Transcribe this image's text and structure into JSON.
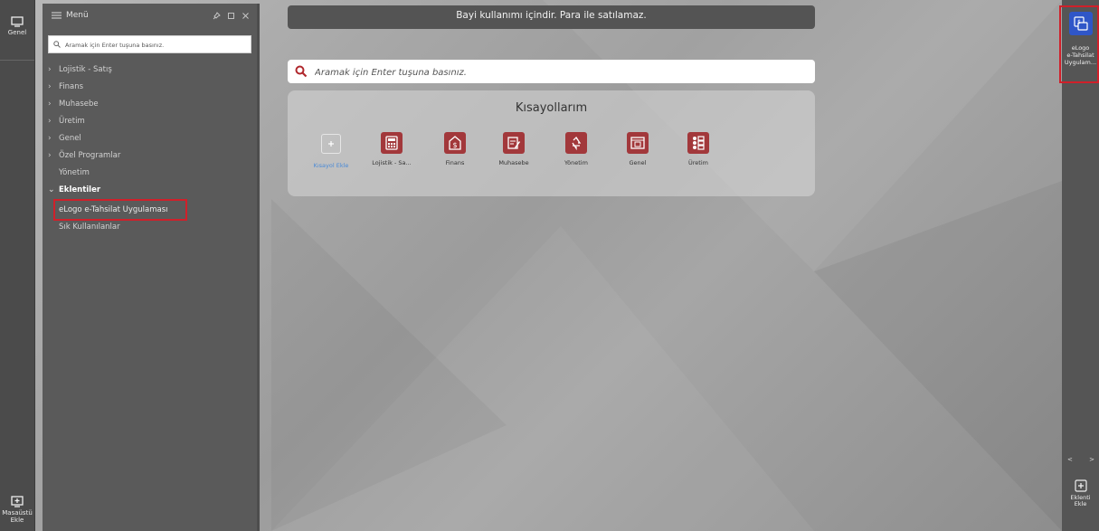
{
  "left_strip": {
    "top_item": {
      "label": "Genel",
      "icon": "monitor-icon"
    },
    "bottom_item": {
      "label_line1": "Masaüstü",
      "label_line2": "Ekle",
      "icon": "add-desktop-icon"
    }
  },
  "menu": {
    "title": "Menü",
    "controls": [
      "pin-icon",
      "restore-icon",
      "close-icon"
    ],
    "search_placeholder": "Aramak için Enter tuşuna basınız.",
    "items": [
      {
        "label": "Lojistik - Satış",
        "expandable": true
      },
      {
        "label": "Finans",
        "expandable": true
      },
      {
        "label": "Muhasebe",
        "expandable": true
      },
      {
        "label": "Üretim",
        "expandable": true
      },
      {
        "label": "Genel",
        "expandable": true
      },
      {
        "label": "Özel Programlar",
        "expandable": true
      },
      {
        "label": "Yönetim",
        "expandable": false
      },
      {
        "label": "Eklentiler",
        "expanded": true
      },
      {
        "label": "eLogo e-Tahsilat Uygulaması",
        "sub": true
      },
      {
        "label": "Sık Kullanılanlar",
        "expandable": false
      }
    ]
  },
  "banner": {
    "text": "Bayi kullanımı içindir. Para ile satılamaz."
  },
  "main_search": {
    "placeholder": "Aramak için Enter tuşuna basınız."
  },
  "shortcuts": {
    "title": "Kısayollarım",
    "tiles": [
      {
        "label": "Kısayol Ekle",
        "icon": "add-shortcut-icon"
      },
      {
        "label": "Lojistik - Sa...",
        "icon": "calculator-icon"
      },
      {
        "label": "Finans",
        "icon": "dollar-icon"
      },
      {
        "label": "Muhasebe",
        "icon": "ledger-icon"
      },
      {
        "label": "Yönetim",
        "icon": "recycle-icon"
      },
      {
        "label": "Genel",
        "icon": "window-icon"
      },
      {
        "label": "Üretim",
        "icon": "checklist-icon"
      }
    ]
  },
  "right_strip": {
    "app": {
      "line1": "eLogo",
      "line2": "e-Tahsilat",
      "line3": "Uygulam...",
      "icon": "payment-app-icon"
    },
    "nav": [
      "<",
      ">"
    ],
    "add": {
      "line1": "Eklenti",
      "line2": "Ekle"
    }
  },
  "colors": {
    "accent_red": "#a2383b",
    "highlight_box": "#d0202a",
    "app_blue": "#2f56c8"
  }
}
